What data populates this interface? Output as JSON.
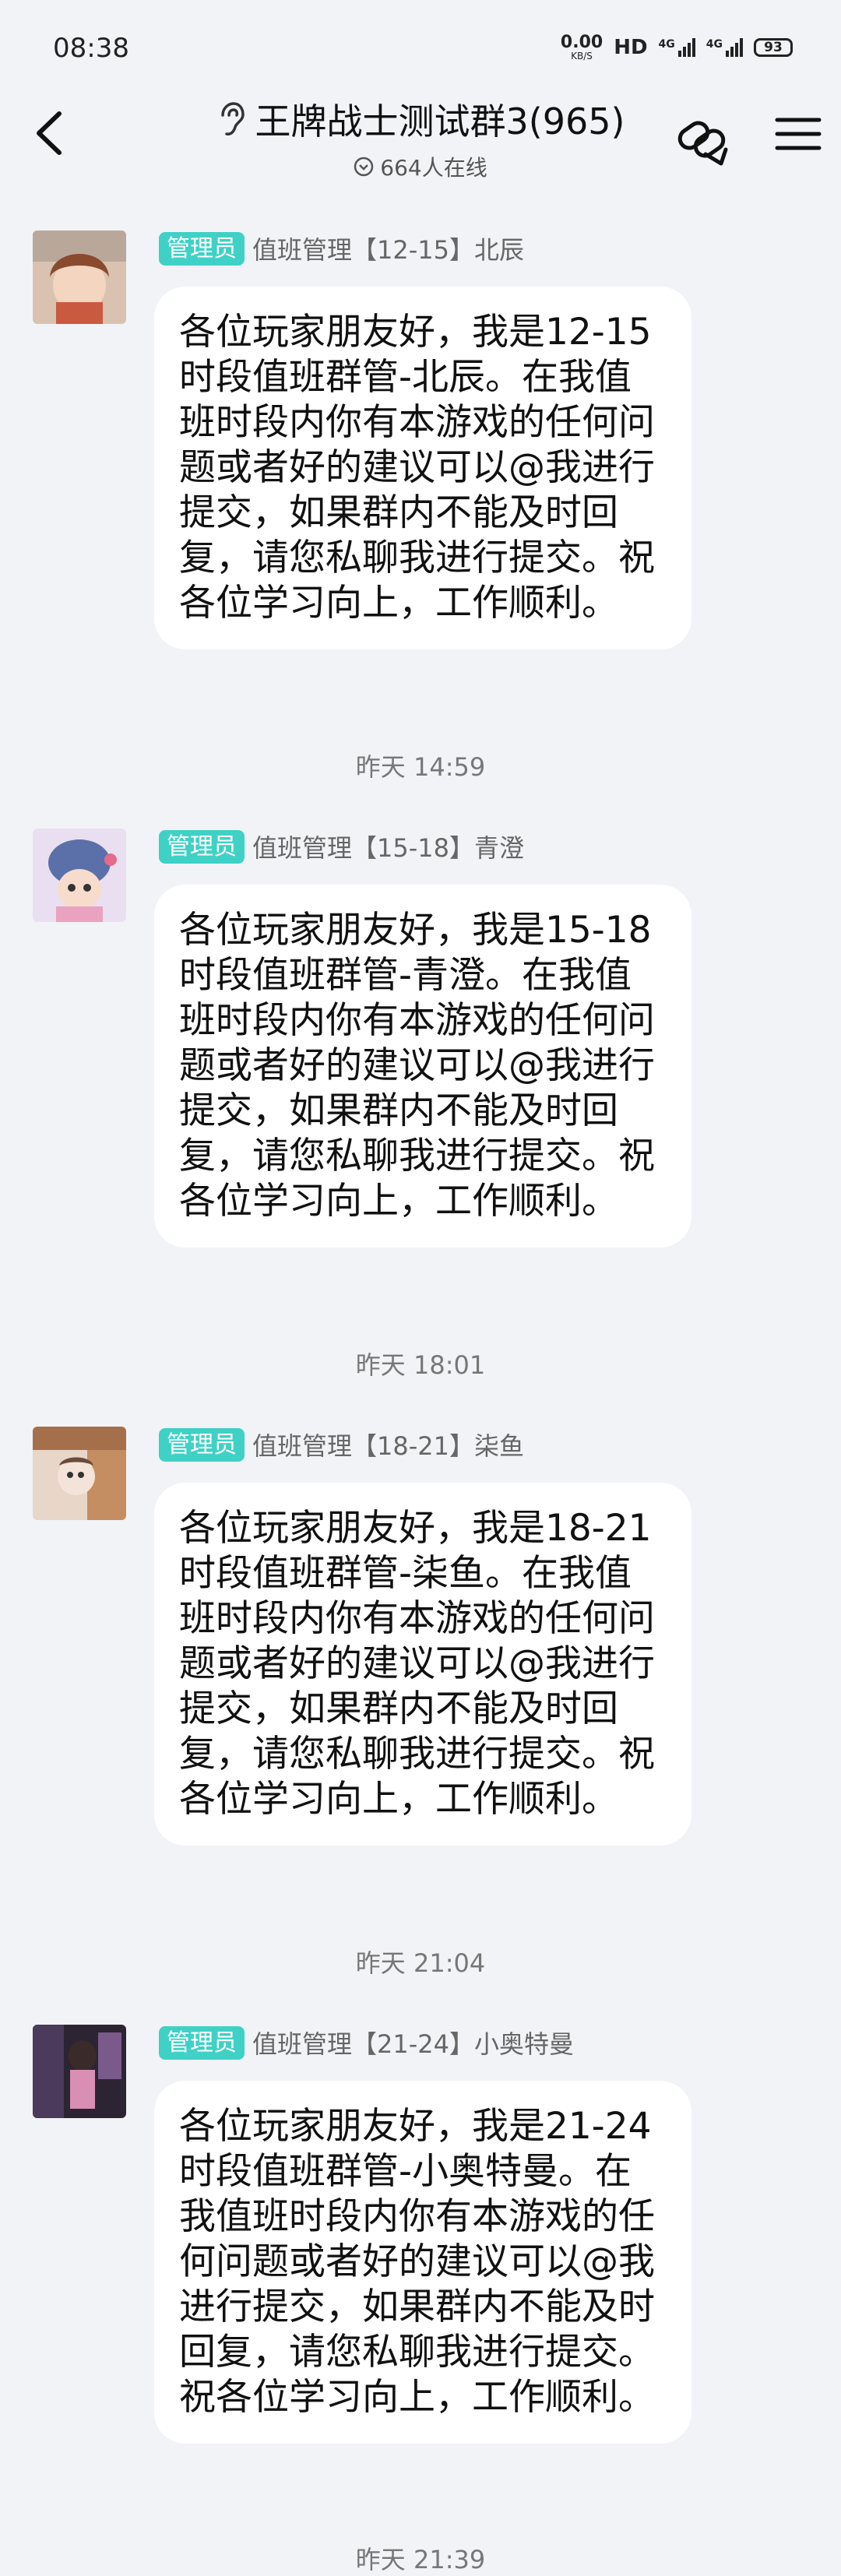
{
  "status_bar": {
    "time": "08:38",
    "net_speed_value": "0.00",
    "net_speed_unit": "KB/S",
    "hd": "HD",
    "sim1": "4G",
    "sim2": "4G",
    "battery": "93"
  },
  "header": {
    "title": "王牌战士测试群3(965)",
    "online": "664人在线"
  },
  "messages": [
    {
      "badge": "管理员",
      "sender": "值班管理【12-15】北辰",
      "text": "各位玩家朋友好，我是12-15时段值班群管-北辰。在我值班时段内你有本游戏的任何问题或者好的建议可以@我进行提交，如果群内不能及时回复，请您私聊我进行提交。祝各位学习向上，工作顺利。"
    },
    {
      "badge": "管理员",
      "sender": "值班管理【15-18】青澄",
      "text": "各位玩家朋友好，我是15-18时段值班群管-青澄。在我值班时段内你有本游戏的任何问题或者好的建议可以@我进行提交，如果群内不能及时回复，请您私聊我进行提交。祝各位学习向上，工作顺利。"
    },
    {
      "badge": "管理员",
      "sender": "值班管理【18-21】柒鱼",
      "text": "各位玩家朋友好，我是18-21时段值班群管-柒鱼。在我值班时段内你有本游戏的任何问题或者好的建议可以@我进行提交，如果群内不能及时回复，请您私聊我进行提交。祝各位学习向上，工作顺利。"
    },
    {
      "badge": "管理员",
      "sender": "值班管理【21-24】小奥特曼",
      "text": "各位玩家朋友好，我是21-24时段值班群管-小奥特曼。在我值班时段内你有本游戏的任何问题或者好的建议可以@我进行提交，如果群内不能及时回复，请您私聊我进行提交。祝各位学习向上，工作顺利。"
    }
  ],
  "timestamps": [
    "昨天 14:59",
    "昨天 18:01",
    "昨天 21:04",
    "昨天 21:39"
  ],
  "colors": {
    "background": "#f2f3f7",
    "badge": "#3fd1c6",
    "bubble": "#ffffff"
  }
}
